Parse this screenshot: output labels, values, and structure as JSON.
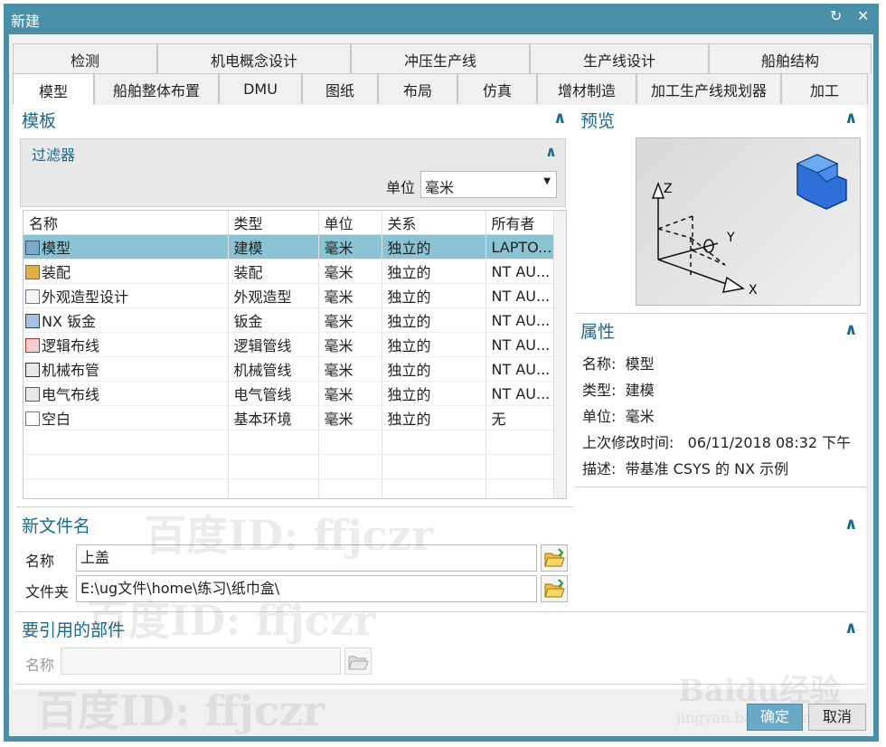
{
  "window": {
    "title": "新建"
  },
  "tabs_top": [
    "检测",
    "机电概念设计",
    "冲压生产线",
    "生产线设计",
    "船舶结构"
  ],
  "tabs_bottom": [
    "模型",
    "船舶整体布置",
    "DMU",
    "图纸",
    "布局",
    "仿真",
    "增材制造",
    "加工生产线规划器",
    "加工"
  ],
  "template": {
    "title": "模板",
    "filter": {
      "title": "过滤器",
      "unit_label": "单位",
      "unit_value": "毫米"
    },
    "columns": [
      "名称",
      "类型",
      "单位",
      "关系",
      "所有者"
    ],
    "rows": [
      [
        "模型",
        "建模",
        "毫米",
        "独立的",
        "LAPTO..."
      ],
      [
        "装配",
        "装配",
        "毫米",
        "独立的",
        "NT AU..."
      ],
      [
        "外观造型设计",
        "外观造型",
        "毫米",
        "独立的",
        "NT AU..."
      ],
      [
        "NX 钣金",
        "钣金",
        "毫米",
        "独立的",
        "NT AU..."
      ],
      [
        "逻辑布线",
        "逻辑管线",
        "毫米",
        "独立的",
        "NT AU..."
      ],
      [
        "机械布管",
        "机械管线",
        "毫米",
        "独立的",
        "NT AU..."
      ],
      [
        "电气布线",
        "电气管线",
        "毫米",
        "独立的",
        "NT AU..."
      ],
      [
        "空白",
        "基本环境",
        "毫米",
        "独立的",
        "无"
      ]
    ]
  },
  "preview": {
    "title": "预览",
    "axis_x": "X",
    "axis_y": "Y",
    "axis_z": "Z"
  },
  "properties": {
    "title": "属性",
    "items": [
      {
        "label": "名称:",
        "value": "模型"
      },
      {
        "label": "类型:",
        "value": "建模"
      },
      {
        "label": "单位:",
        "value": "毫米"
      },
      {
        "label": "上次修改时间:",
        "value": "06/11/2018 08:32 下午"
      },
      {
        "label": "描述:",
        "value": "带基准 CSYS 的 NX 示例"
      }
    ]
  },
  "new_file": {
    "title": "新文件名",
    "name_label": "名称",
    "name_value": "上盖",
    "folder_label": "文件夹",
    "folder_value": "E:\\ug文件\\home\\练习\\纸巾盒\\"
  },
  "ref_part": {
    "title": "要引用的部件",
    "name_label": "名称"
  },
  "buttons": {
    "ok": "确定",
    "cancel": "取消"
  },
  "watermark": {
    "text": "百度ID: ffjczr",
    "brand": "Baidu经验",
    "url": "jingyan.baidu.com"
  }
}
